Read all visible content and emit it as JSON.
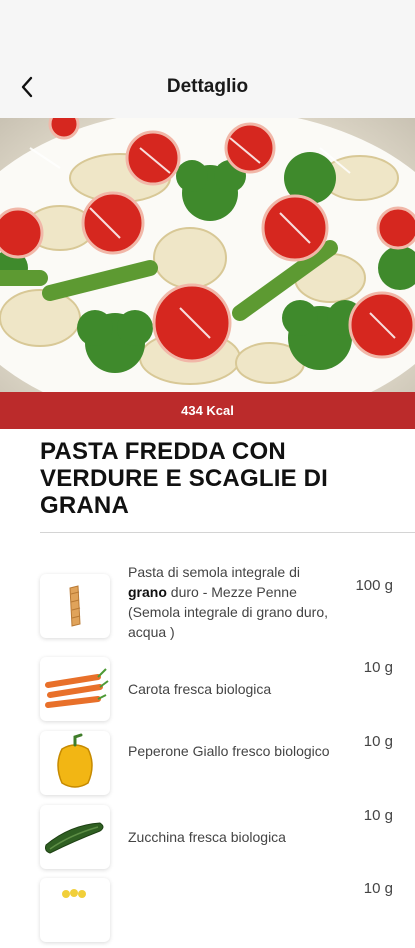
{
  "header": {
    "title": "Dettaglio",
    "back_icon": "chevron-left-icon"
  },
  "recipe": {
    "kcal": "434 Kcal",
    "title": "PASTA FREDDA CON VERDURE E SCAGLIE DI GRANA"
  },
  "ingredients": [
    {
      "name_before": "Pasta di semola integrale di ",
      "name_bold": "grano",
      "name_after": " duro - Mezze Penne (Semola integrale di grano duro, acqua )",
      "quantity": "100 g",
      "icon": "pasta-icon"
    },
    {
      "name": "Carota fresca biologica",
      "quantity": "10 g",
      "icon": "carrot-icon"
    },
    {
      "name": "Peperone Giallo fresco biologico",
      "quantity": "10 g",
      "icon": "pepper-icon"
    },
    {
      "name": "Zucchina fresca biologica",
      "quantity": "10 g",
      "icon": "zucchini-icon"
    },
    {
      "name": "",
      "quantity": "10 g",
      "icon": "corn-icon"
    }
  ],
  "colors": {
    "accent": "#bb2b2b",
    "header_bg": "#f6f6f6"
  }
}
